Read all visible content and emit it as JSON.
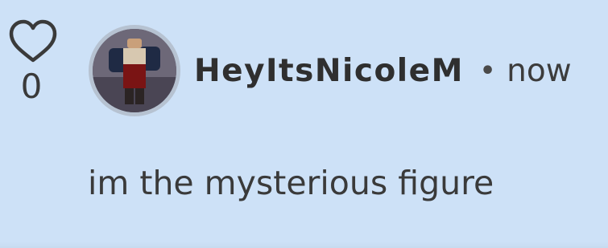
{
  "like": {
    "icon": "heart-outline-icon",
    "count": "0"
  },
  "comment": {
    "author": "HeyItsNicoleM",
    "separator": "•",
    "timestamp": "now",
    "text": "im the mysterious figure"
  },
  "colors": {
    "background": "#cde1f7",
    "text": "#3a3a3a",
    "username": "#2f2f2f",
    "avatar_ring": "#b6c2d1"
  }
}
